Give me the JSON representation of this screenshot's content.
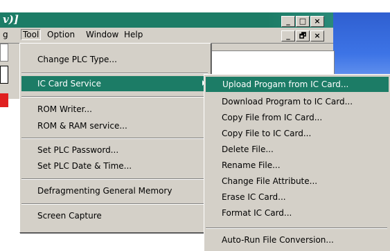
{
  "window": {
    "title": "v)]",
    "controls": [
      "_",
      "□",
      "×"
    ],
    "mdi_controls": [
      "_",
      "🗗",
      "×"
    ]
  },
  "menubar": {
    "items": [
      "g",
      "Tool",
      "Option",
      "Window",
      "Help"
    ]
  },
  "tool_menu": {
    "items": [
      {
        "label": "Change PLC Type..."
      },
      {
        "label": "IC Card Service",
        "has_submenu": true,
        "highlighted": true
      },
      {
        "label": "ROM Writer..."
      },
      {
        "label": "ROM & RAM service..."
      },
      {
        "label": "Set PLC Password..."
      },
      {
        "label": "Set PLC Date & Time..."
      },
      {
        "label": "Defragmenting General Memory"
      },
      {
        "label": "Screen Capture"
      }
    ]
  },
  "ic_card_submenu": {
    "items": [
      {
        "label": "Upload Progam from IC Card...",
        "highlighted": true
      },
      {
        "label": "Download Program to IC Card..."
      },
      {
        "label": "Copy File from IC Card..."
      },
      {
        "label": "Copy File to IC Card..."
      },
      {
        "label": "Delete File..."
      },
      {
        "label": "Rename File..."
      },
      {
        "label": "Change File Attribute..."
      },
      {
        "label": "Erase IC Card..."
      },
      {
        "label": "Format IC Card..."
      },
      {
        "label": "Auto-Run File Conversion..."
      }
    ]
  },
  "colors": {
    "highlight": "#1c7c66",
    "menu_bg": "#d4d0c8"
  }
}
